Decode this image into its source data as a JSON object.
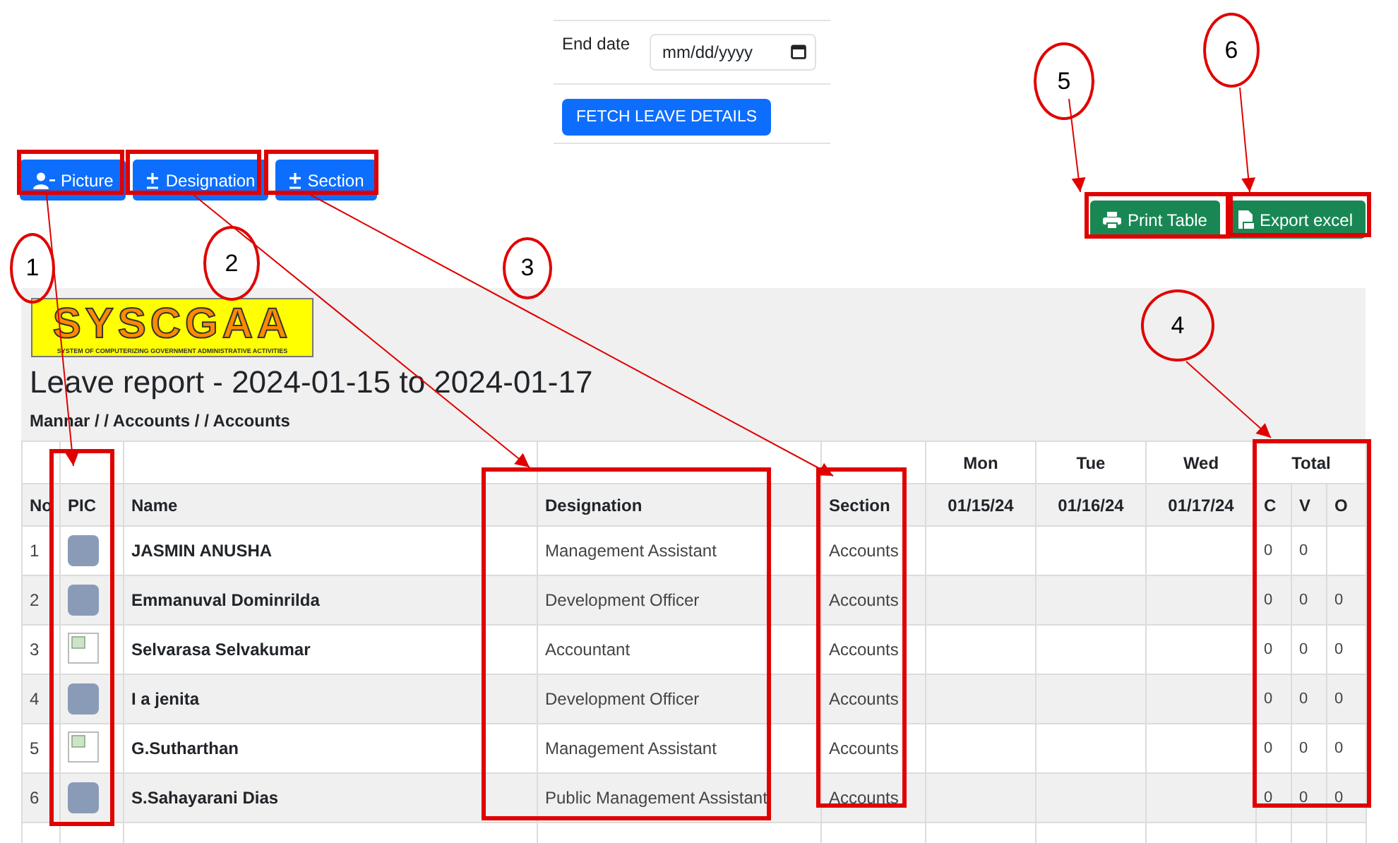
{
  "filter": {
    "end_date": {
      "label": "End date",
      "placeholder": "mm/dd/yyyy"
    },
    "fetch_button": "FETCH LEAVE DETAILS"
  },
  "column_toggles": [
    {
      "label": "Picture"
    },
    {
      "label": "Designation"
    },
    {
      "label": "Section"
    }
  ],
  "actions": [
    {
      "label": "Print Table"
    },
    {
      "label": "Export excel"
    }
  ],
  "report": {
    "logo": {
      "wordmark": "SYSCGAA",
      "tagline": "SYSTEM OF COMPUTERIZING GOVERNMENT ADMINISTRATIVE ACTIVITIES"
    },
    "title": "Leave report - 2024-01-15 to 2024-01-17",
    "subtitle": "Mannar / / Accounts / / Accounts",
    "day_headers": [
      "Mon",
      "Tue",
      "Wed"
    ],
    "total_header": "Total",
    "columns": [
      "No",
      "PIC",
      "Name",
      "Designation",
      "Section",
      "01/15/24",
      "01/16/24",
      "01/17/24",
      "C",
      "V",
      "O"
    ],
    "rows": [
      {
        "no": "1",
        "kind": "photo",
        "name": "JASMIN ANUSHA",
        "designation": "Management Assistant",
        "section": "Accounts",
        "totals": [
          "0",
          "0"
        ]
      },
      {
        "no": "2",
        "kind": "photo",
        "name": "Emmanuval Dominrilda",
        "designation": "Development Officer",
        "section": "Accounts",
        "totals": [
          "0",
          "0",
          "0"
        ]
      },
      {
        "no": "3",
        "kind": "broken",
        "name": "Selvarasa Selvakumar",
        "designation": "Accountant",
        "section": "Accounts",
        "totals": [
          "0",
          "0",
          "0"
        ]
      },
      {
        "no": "4",
        "kind": "photo",
        "name": "I a jenita",
        "designation": "Development Officer",
        "section": "Accounts",
        "totals": [
          "0",
          "0",
          "0"
        ]
      },
      {
        "no": "5",
        "kind": "broken",
        "name": "G.Sutharthan",
        "designation": "Management Assistant",
        "section": "Accounts",
        "totals": [
          "0",
          "0",
          "0"
        ]
      },
      {
        "no": "6",
        "kind": "photo",
        "name": "S.Sahayarani Dias",
        "designation": "Public Management Assistant",
        "section": "Accounts",
        "totals": [
          "0",
          "0",
          "0"
        ]
      }
    ]
  },
  "annotations": {
    "callouts": [
      "1",
      "2",
      "3",
      "4",
      "5",
      "6"
    ]
  }
}
